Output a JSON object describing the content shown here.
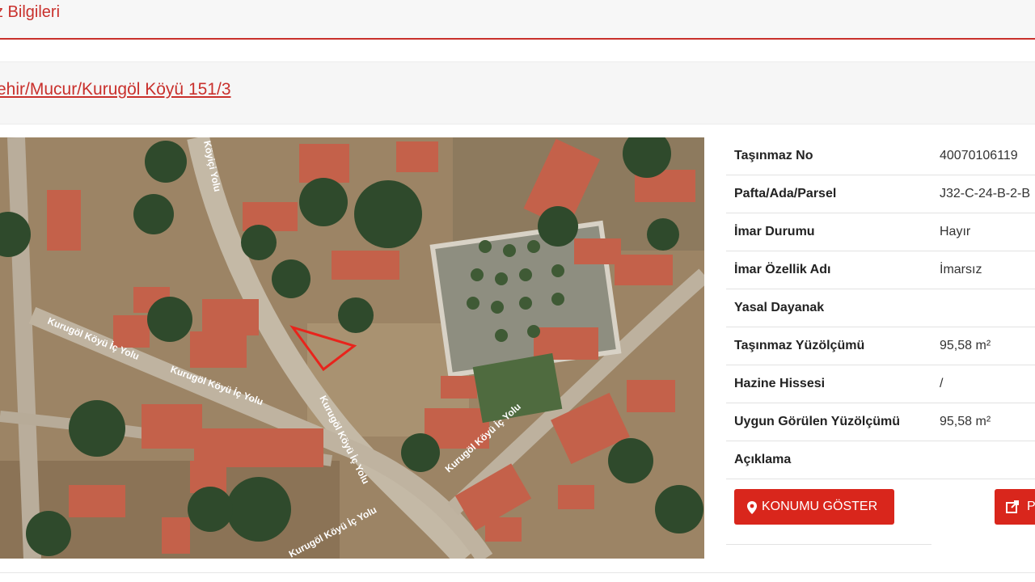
{
  "header": {
    "title": "z Bilgileri"
  },
  "address": {
    "text": "ehir/Mucur/Kurugöl Köyü 151/3"
  },
  "map": {
    "road_labels": [
      "Kurugöl Köyü İç Yolu",
      "Kurugöl Köyü İç Yolu",
      "Kurugöl Köyü İç Yolu",
      "Kurugöl Köyü İç Yolu",
      "Kurugöl Köyü İç Yolu",
      "Köyiçi Yolu"
    ],
    "parcel_color": "#e8241c"
  },
  "info": {
    "rows": [
      {
        "label": "Taşınmaz No",
        "value": "40070106119"
      },
      {
        "label": "Pafta/Ada/Parsel",
        "value": "J32-C-24-B-2-B"
      },
      {
        "label": "İmar Durumu",
        "value": "Hayır"
      },
      {
        "label": "İmar Özellik Adı",
        "value": "İmarsız"
      },
      {
        "label": "Yasal Dayanak",
        "value": ""
      },
      {
        "label": "Taşınmaz Yüzölçümü",
        "value": "95,58 m²"
      },
      {
        "label": "Hazine Hissesi",
        "value": "/"
      },
      {
        "label": "Uygun Görülen Yüzölçümü",
        "value": "95,58 m²"
      },
      {
        "label": "Açıklama",
        "value": ""
      }
    ]
  },
  "buttons": {
    "location": {
      "icon": "map-marker-icon",
      "label": "KONUMU GÖSTER"
    },
    "share": {
      "icon": "share-icon",
      "label": "P"
    }
  },
  "colors": {
    "accent": "#c9302c",
    "button": "#d9261c"
  }
}
